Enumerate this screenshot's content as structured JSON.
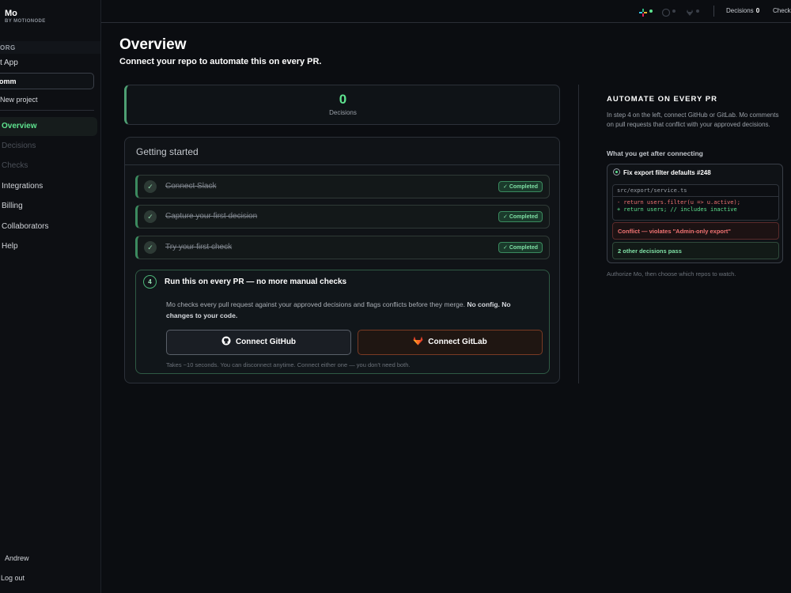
{
  "brand": {
    "name": "Mo",
    "sub": "BY MOTIONODE"
  },
  "sidebar": {
    "org_label": "ORG",
    "app_item": "t App",
    "org_select": "omm",
    "new_project": "New project",
    "nav": [
      {
        "label": "Overview",
        "state": "active"
      },
      {
        "label": "Decisions",
        "state": "disabled"
      },
      {
        "label": "Checks",
        "state": "disabled"
      },
      {
        "label": "Integrations",
        "state": "normal"
      },
      {
        "label": "Billing",
        "state": "normal"
      },
      {
        "label": "Collaborators",
        "state": "normal"
      },
      {
        "label": "Help",
        "state": "normal"
      }
    ],
    "user": "Andrew",
    "logout": "Log out"
  },
  "topbar": {
    "icons": [
      "slack-icon",
      "github-icon",
      "gitlab-icon"
    ],
    "decisions_label": "Decisions",
    "decisions_count": "0",
    "checks_label": "Check"
  },
  "header": {
    "title": "Overview",
    "subtitle": "Connect your repo to automate this on every PR."
  },
  "stats": {
    "decisions_count": "0",
    "decisions_label": "Decisions"
  },
  "getting_started": {
    "title": "Getting started",
    "steps": [
      {
        "label": "Connect Slack",
        "status": "Completed"
      },
      {
        "label": "Capture your first decision",
        "status": "Completed"
      },
      {
        "label": "Try your first check",
        "status": "Completed"
      }
    ],
    "step4": {
      "number": "4",
      "title": "Run this on every PR — no more manual checks",
      "description": "Mo checks every pull request against your approved decisions and flags conflicts before they merge.",
      "description_bold": "No config. No changes to your code.",
      "github_button": "Connect GitHub",
      "gitlab_button": "Connect GitLab",
      "footnote": "Takes ~10 seconds. You can disconnect anytime. Connect either one — you don't need both."
    }
  },
  "right_panel": {
    "title": "AUTOMATE ON EVERY PR",
    "description": "In step 4 on the left, connect GitHub or GitLab. Mo comments on pull requests that conflict with your approved decisions.",
    "after_label": "What you get after connecting",
    "pr_title": "Fix export filter defaults #248",
    "code_file": "src/export/service.ts",
    "code_removed": "- return users.filter(u => u.active);",
    "code_added": "+ return users; // includes inactive",
    "conflict": "Conflict — violates \"Admin-only export\"",
    "pass": "2 other decisions pass",
    "footnote": "Authorize Mo, then choose which repos to watch."
  },
  "colors": {
    "accent": "#5ee38f",
    "conflict": "#f07272",
    "gitlab": "#e24329",
    "bg": "#0b0d11"
  }
}
